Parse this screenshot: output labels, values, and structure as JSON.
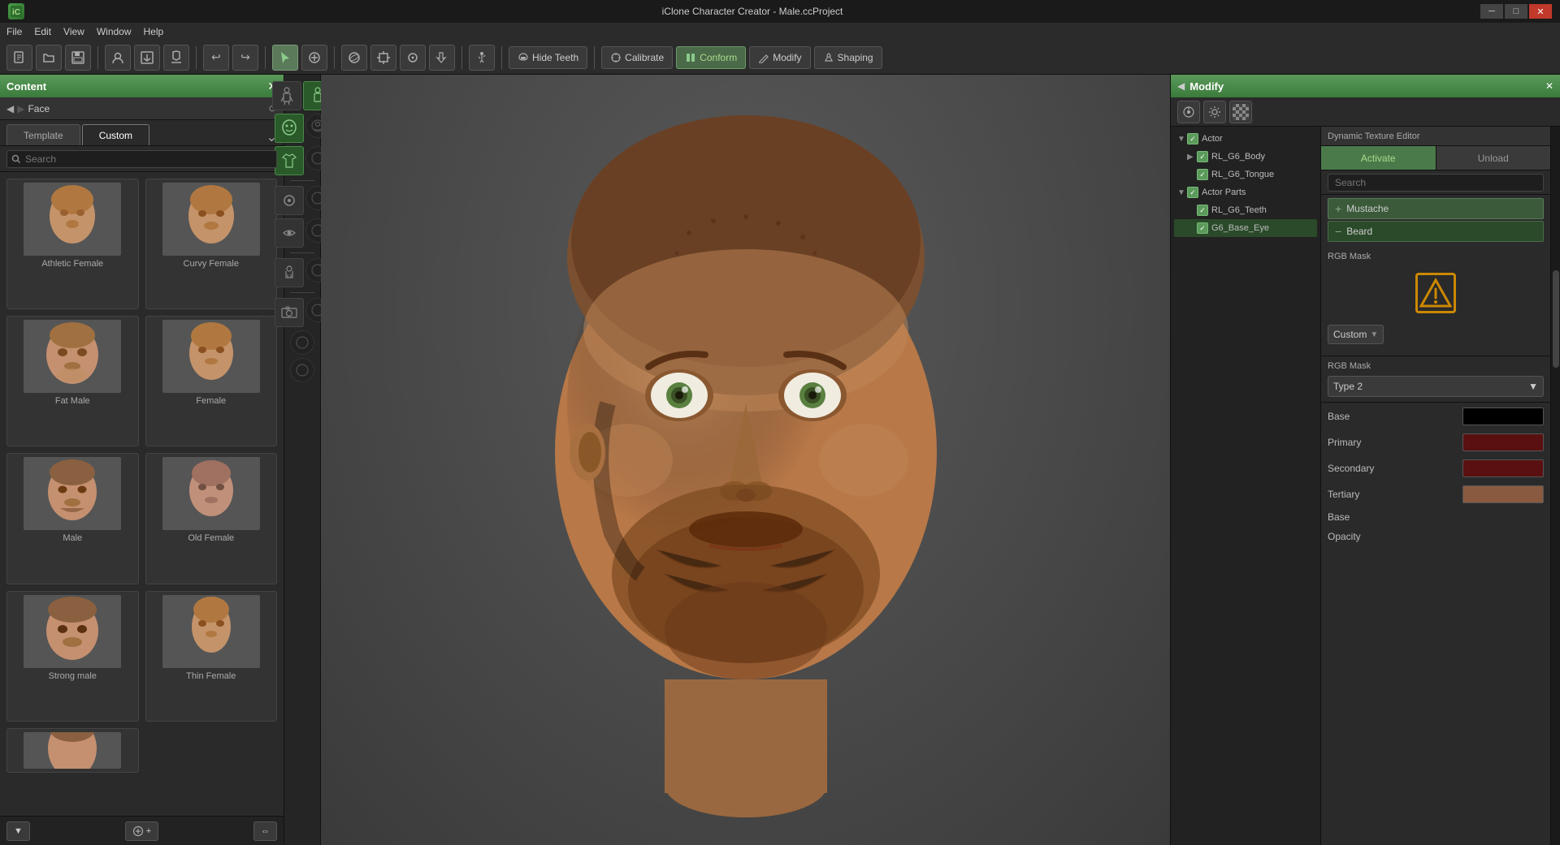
{
  "window": {
    "title": "iClone Character Creator - Male.ccProject",
    "controls": {
      "minimize": "─",
      "maximize": "□",
      "close": "✕"
    }
  },
  "menu": {
    "items": [
      "File",
      "Edit",
      "View",
      "Window",
      "Help"
    ]
  },
  "toolbar": {
    "buttons": [
      {
        "name": "new",
        "icon": "📄"
      },
      {
        "name": "open",
        "icon": "📁"
      },
      {
        "name": "save",
        "icon": "💾"
      },
      {
        "name": "profile",
        "icon": "👤"
      },
      {
        "name": "import",
        "icon": "📥"
      },
      {
        "name": "export",
        "icon": "📤"
      }
    ],
    "undo_label": "↩",
    "redo_label": "↪",
    "hide_teeth_label": "Hide Teeth",
    "calibrate_label": "Calibrate",
    "conform_label": "Conform",
    "modify_label": "Modify",
    "shaping_label": "Shaping"
  },
  "content_panel": {
    "title": "Content",
    "breadcrumb": {
      "back": "←",
      "path": "Face"
    },
    "tabs": {
      "template": "Template",
      "custom": "Custom"
    },
    "search_placeholder": "Search",
    "characters": [
      {
        "name": "Athletic Female",
        "id": "athletic-female"
      },
      {
        "name": "Curvy Female",
        "id": "curvy-female"
      },
      {
        "name": "Fat Male",
        "id": "fat-male"
      },
      {
        "name": "Female",
        "id": "female"
      },
      {
        "name": "Male",
        "id": "male"
      },
      {
        "name": "Old Female",
        "id": "old-female"
      },
      {
        "name": "Strong male",
        "id": "strong-male"
      },
      {
        "name": "Thin Female",
        "id": "thin-female"
      }
    ]
  },
  "modify_panel": {
    "title": "Modify",
    "dte_title": "Dynamic Texture Editor",
    "activate_label": "Activate",
    "unload_label": "Unload",
    "search_placeholder": "Search",
    "mustache_label": "Mustache",
    "beard_label": "Beard",
    "rgb_mask_label": "RGB Mask",
    "warning_symbol": "⚠",
    "custom_dropdown": "Custom",
    "rgb_mask_type_label": "RGB Mask",
    "rgb_mask_type_value": "Type 2",
    "base_label": "Base",
    "primary_label": "Primary",
    "secondary_label": "Secondary",
    "tertiary_label": "Tertiary",
    "base_opacity_label": "Base",
    "opacity_label": "Opacity",
    "colors": {
      "base": "#000000",
      "primary": "#5a1010",
      "secondary": "#5a1010",
      "tertiary": "#8a5a40"
    },
    "tree": {
      "actor": "Actor",
      "rl_g6_body": "RL_G6_Body",
      "rl_g6_tongue": "RL_G6_Tongue",
      "actor_parts": "Actor Parts",
      "rl_g6_teeth": "RL_G6_Teeth",
      "g6_base_eye": "G6_Base_Eye"
    }
  }
}
